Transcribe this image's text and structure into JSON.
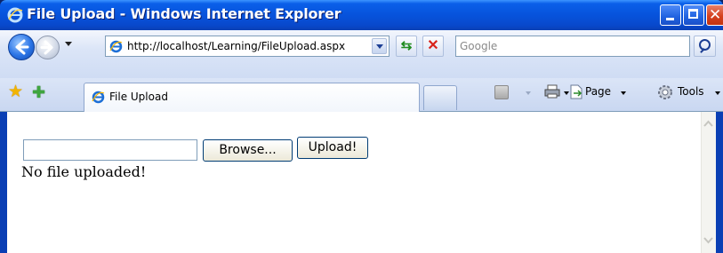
{
  "window": {
    "title": "File Upload - Windows Internet Explorer"
  },
  "navigation": {
    "address": "http://localhost/Learning/FileUpload.aspx",
    "search_placeholder": "Google"
  },
  "tabs": [
    {
      "label": "File Upload",
      "active": true
    }
  ],
  "toolbar": {
    "page_label": "Page",
    "tools_label": "Tools"
  },
  "form": {
    "browse_label": "Browse...",
    "upload_label": "Upload!",
    "status_text": "No file uploaded!"
  },
  "colors": {
    "titlebar_blue": "#0753dc",
    "close_red": "#d5411e",
    "content_bg": "#ffffff"
  },
  "icons": [
    "ie-icon",
    "back-arrow-icon",
    "forward-arrow-icon",
    "refresh-icon",
    "stop-icon",
    "search-icon",
    "favorites-star-icon",
    "add-favorite-icon",
    "feeds-icon",
    "print-icon",
    "page-icon",
    "gear-icon"
  ]
}
